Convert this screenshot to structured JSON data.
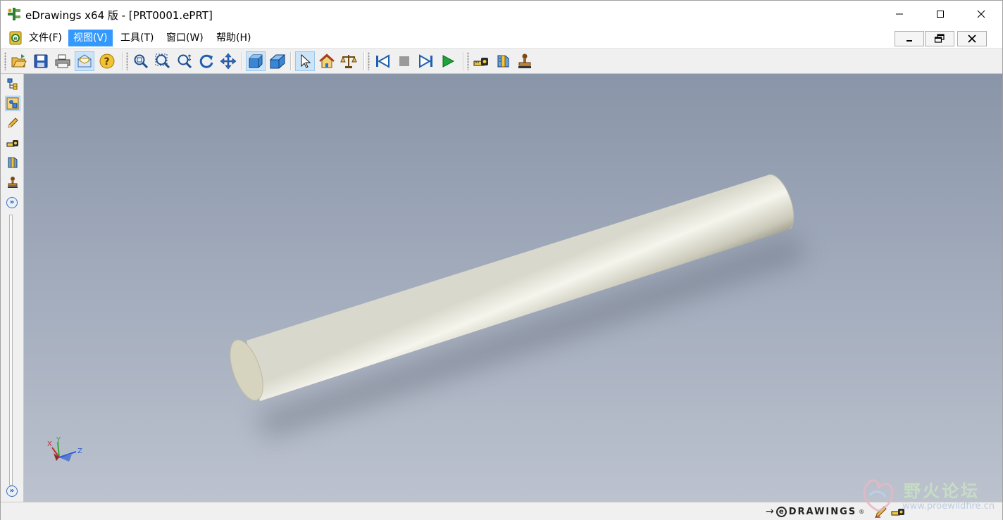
{
  "window": {
    "title": "eDrawings x64 版 - [PRT0001.ePRT]",
    "caption_buttons": [
      "minimize",
      "maximize",
      "close"
    ]
  },
  "menu": {
    "items": [
      {
        "label": "文件(F)",
        "active": false
      },
      {
        "label": "视图(V)",
        "active": true
      },
      {
        "label": "工具(T)",
        "active": false
      },
      {
        "label": "窗口(W)",
        "active": false
      },
      {
        "label": "帮助(H)",
        "active": false
      }
    ],
    "mdi_buttons": [
      "minimize",
      "restore",
      "close"
    ]
  },
  "toolbar": {
    "groups": [
      [
        "open-icon",
        "save-icon",
        "print-icon",
        "send-mail-icon",
        "help-icon"
      ],
      [
        "zoom-to-fit-icon",
        "zoom-to-area-icon",
        "zoom-in-out-icon",
        "rotate-icon",
        "pan-icon"
      ],
      [
        "shaded-icon",
        "perspective-icon"
      ],
      [
        "select-icon",
        "home-icon",
        "balance-icon"
      ],
      [
        "previous-icon",
        "stop-icon",
        "next-icon",
        "play-icon"
      ],
      [
        "measure-icon",
        "section-icon",
        "stamp-icon"
      ]
    ],
    "pressed": [
      "send-mail-icon",
      "shaded-icon",
      "select-icon"
    ]
  },
  "left_panel": {
    "buttons": [
      "components-icon",
      "configurations-icon",
      "markup-pencil-icon",
      "measure-icon",
      "section-icon",
      "stamp-icon"
    ],
    "expand_top": "»",
    "expand_bottom": "»"
  },
  "viewport": {
    "background_top": "#8995a8",
    "background_bottom": "#bcc2ce",
    "model": "cylinder",
    "triad": {
      "x_label": "X",
      "y_label": "Y",
      "z_label": "Z"
    }
  },
  "statusbar": {
    "brand_prefix": "→",
    "brand_e": "e",
    "brand_word": "DRAWINGS",
    "brand_reg": "®"
  },
  "watermark": {
    "title": "野火论坛",
    "url": "www.proewildfire.cn"
  }
}
